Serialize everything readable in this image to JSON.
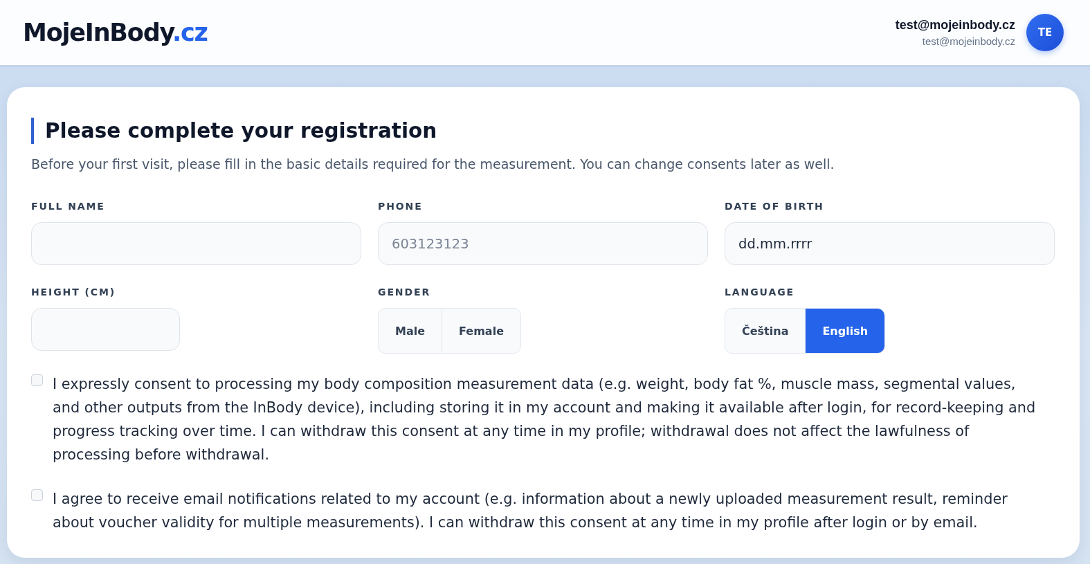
{
  "header": {
    "logo": {
      "name": "MojeInBody",
      "suffix": ".cz"
    },
    "user": {
      "name": "test@mojeinbody.cz",
      "email": "test@mojeinbody.cz",
      "initials": "TE"
    }
  },
  "form": {
    "title": "Please complete your registration",
    "subtitle": "Before your first visit, please fill in the basic details required for the measurement. You can change consents later as well.",
    "fields": [
      {
        "kind": "text",
        "label": "FULL NAME"
      },
      {
        "kind": "text",
        "label": "PHONE",
        "placeholder": "603123123"
      },
      {
        "kind": "date",
        "label": "DATE OF BIRTH",
        "placeholder": "dd.mm.rrrr"
      },
      {
        "kind": "number",
        "label": "HEIGHT (CM)"
      },
      {
        "kind": "choice",
        "label": "GENDER",
        "options": [
          {
            "label": "Male",
            "selected": false
          },
          {
            "label": "Female",
            "selected": false
          }
        ]
      },
      {
        "kind": "choice",
        "label": "LANGUAGE",
        "options": [
          {
            "label": "Čeština",
            "selected": false
          },
          {
            "label": "English",
            "selected": true
          }
        ]
      }
    ],
    "consents": [
      {
        "text": "I expressly consent to processing my body composition measurement data (e.g. weight, body fat %, muscle mass, segmental values, and other outputs from the InBody device), including storing it in my account and making it available after login, for record-keeping and progress tracking over time. I can withdraw this consent at any time in my profile; withdrawal does not affect the lawfulness of processing before withdrawal.",
        "checked": false
      },
      {
        "text": "I agree to receive email notifications related to my account (e.g. information about a newly uploaded measurement result, reminder about voucher validity for multiple measurements). I can withdraw this consent at any time in my profile after login or by email.",
        "checked": false
      }
    ]
  }
}
